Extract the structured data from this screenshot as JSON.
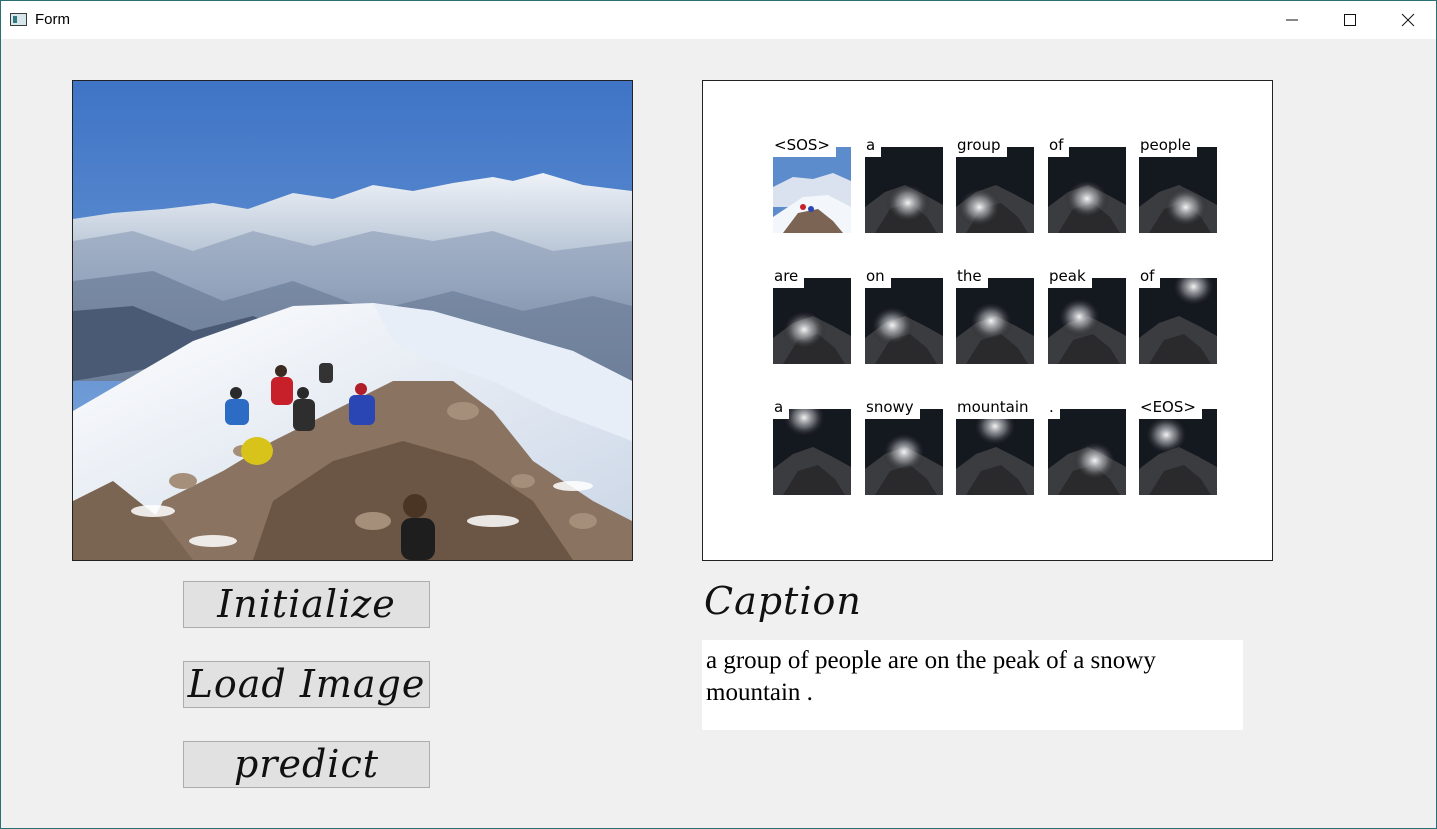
{
  "window": {
    "title": "Form"
  },
  "image": {
    "alt_subject": "hikers resting on a snowy mountain peak"
  },
  "attention": {
    "words": [
      "<SOS>",
      "a",
      "group",
      "of",
      "people",
      "are",
      "on",
      "the",
      "peak",
      "of",
      "a",
      "snowy",
      "mountain",
      ".",
      "<EOS>"
    ]
  },
  "buttons": {
    "initialize": "Initialize",
    "load_image": "Load Image",
    "predict": "predict"
  },
  "caption": {
    "label": "Caption",
    "text": "a group of people are on the peak of a snowy mountain ."
  },
  "colors": {
    "window_border": "#2a6f73",
    "background": "#f0f0f0"
  }
}
